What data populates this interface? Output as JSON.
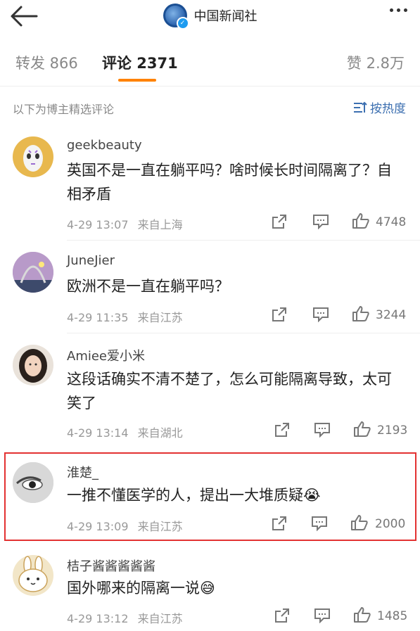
{
  "header": {
    "account_name": "中国新闻社"
  },
  "tabs": [
    {
      "label": "转发 866"
    },
    {
      "label": "评论 2371"
    },
    {
      "label": "赞 2.8万"
    }
  ],
  "subheader": {
    "label": "以下为博主精选评论",
    "sort_label": "按热度"
  },
  "comments": [
    {
      "user": "geekbeauty",
      "text": "英国不是一直在躺平吗？啥时候长时间隔离了？自相矛盾",
      "time": "4-29 13:07",
      "location": "来自上海",
      "likes": "4748"
    },
    {
      "user": "JuneJier",
      "text": "欧洲不是一直在躺平吗？",
      "time": "4-29 11:35",
      "location": "来自江苏",
      "likes": "3244"
    },
    {
      "user": "Amiee爱小米",
      "text": "这段话确实不清不楚了，怎么可能隔离导致，太可笑了",
      "time": "4-29 13:14",
      "location": "来自湖北",
      "likes": "2193"
    },
    {
      "user": "淮楚_",
      "text": "一推不懂医学的人，提出一大堆质疑😭",
      "time": "4-29 13:09",
      "location": "来自江苏",
      "likes": "2000"
    },
    {
      "user": "桔子酱酱酱酱酱",
      "text": "国外哪来的隔离一说😅",
      "time": "4-29 13:12",
      "location": "来自江苏",
      "likes": "1485"
    }
  ],
  "colors": {
    "accent": "#ff8200",
    "link": "#3c6fb0",
    "highlight_border": "#e33232"
  }
}
